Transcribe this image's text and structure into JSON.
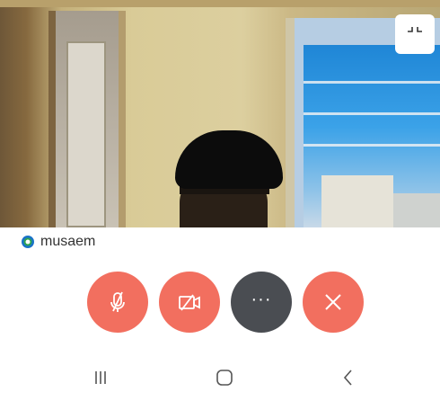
{
  "call": {
    "participant_name": "musaem"
  },
  "icons": {
    "minimize": "minimize-icon",
    "presence": "presence-icon",
    "mute": "microphone-off-icon",
    "video_off": "video-off-icon",
    "more": "more-icon",
    "end": "close-icon",
    "recents": "recents-icon",
    "home": "home-icon",
    "back": "back-icon"
  },
  "controls": {
    "more_label": "···"
  },
  "colors": {
    "control_red": "#f26f5f",
    "control_dark": "#4a4d52",
    "presence_green": "#2ea44f",
    "presence_blue": "#1a73c7"
  }
}
